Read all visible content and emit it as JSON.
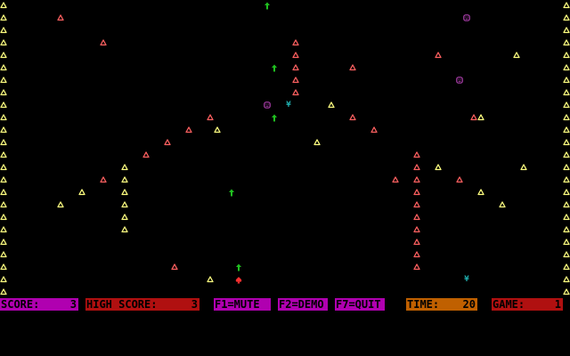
{
  "status_bar": {
    "score": {
      "label": "SCORE:",
      "value": "3"
    },
    "high_score": {
      "label": "HIGH SCORE:",
      "value": "3"
    },
    "mute_key": {
      "label": "F1=MUTE"
    },
    "demo_key": {
      "label": "F2=DEMO"
    },
    "quit_key": {
      "label": "F7=QUIT"
    },
    "time": {
      "label": "TIME:",
      "value": "20"
    },
    "game": {
      "label": "GAME:",
      "value": "1"
    }
  },
  "colors": {
    "yellow_tree": "#ffff80",
    "salmon_tree": "#ff6060",
    "player": "#ff3030",
    "arrow": "#20c020",
    "face": "#b040b0",
    "yen": "#20b0b0",
    "magenta_bar": "#b000b0",
    "red_bar": "#b01010",
    "orange_bar": "#c06000"
  },
  "icons": {
    "tree": "triangle-outline-icon",
    "arrow": "up-arrow-icon",
    "face": "face-icon",
    "yen": "yen-icon",
    "player": "player-spade-icon"
  }
}
